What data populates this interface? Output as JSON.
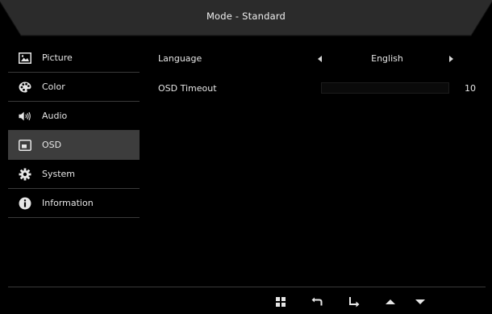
{
  "header": {
    "title": "Mode - Standard"
  },
  "sidebar": {
    "items": [
      {
        "label": "Picture",
        "icon": "picture-icon"
      },
      {
        "label": "Color",
        "icon": "palette-icon"
      },
      {
        "label": "Audio",
        "icon": "speaker-icon"
      },
      {
        "label": "OSD",
        "icon": "osd-window-icon",
        "active": true
      },
      {
        "label": "System",
        "icon": "gear-icon"
      },
      {
        "label": "Information",
        "icon": "info-icon"
      }
    ]
  },
  "main": {
    "language": {
      "label": "Language",
      "value": "English"
    },
    "osd_timeout": {
      "label": "OSD Timeout",
      "value": "10",
      "level": 0
    }
  },
  "footer": {
    "buttons": [
      "menu-grid-icon",
      "back-icon",
      "enter-icon",
      "up-arrow-icon",
      "down-arrow-icon"
    ]
  },
  "colors": {
    "background": "#000000",
    "active_item": "#3d3d3d",
    "text": "#e6e6e6"
  }
}
